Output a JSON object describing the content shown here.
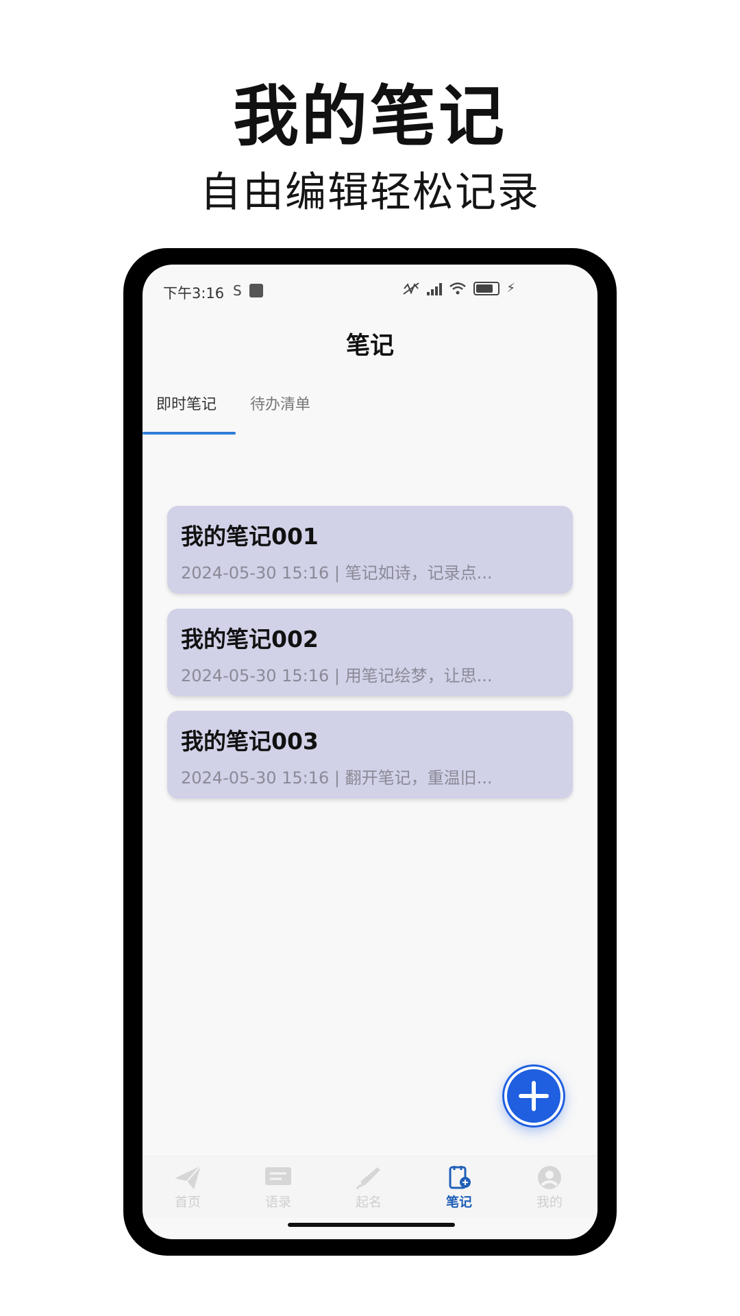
{
  "promo": {
    "title": "我的笔记",
    "subtitle": "自由编辑轻松记录"
  },
  "status_bar": {
    "time": "下午3:16",
    "sim_icon_char": "S"
  },
  "appbar": {
    "title": "笔记"
  },
  "tabs": [
    {
      "label": "即时笔记",
      "active": true
    },
    {
      "label": "待办清单",
      "active": false
    }
  ],
  "notes": [
    {
      "title": "我的笔记001",
      "meta": "2024-05-30 15:16 | 笔记如诗，记录点..."
    },
    {
      "title": "我的笔记002",
      "meta": "2024-05-30 15:16 | 用笔记绘梦，让思..."
    },
    {
      "title": "我的笔记003",
      "meta": "2024-05-30 15:16 | 翻开笔记，重温旧..."
    }
  ],
  "bottom_nav": [
    {
      "label": "首页",
      "icon": "paper-plane-icon",
      "active": false
    },
    {
      "label": "语录",
      "icon": "message-icon",
      "active": false
    },
    {
      "label": "起名",
      "icon": "brush-icon",
      "active": false
    },
    {
      "label": "笔记",
      "icon": "notebook-icon",
      "active": true
    },
    {
      "label": "我的",
      "icon": "user-icon",
      "active": false
    }
  ],
  "colors": {
    "accent": "#1f5fe0",
    "card": "#d1d1e8",
    "tab_indicator": "#2f7dd6",
    "nav_active": "#1f5fb8"
  }
}
